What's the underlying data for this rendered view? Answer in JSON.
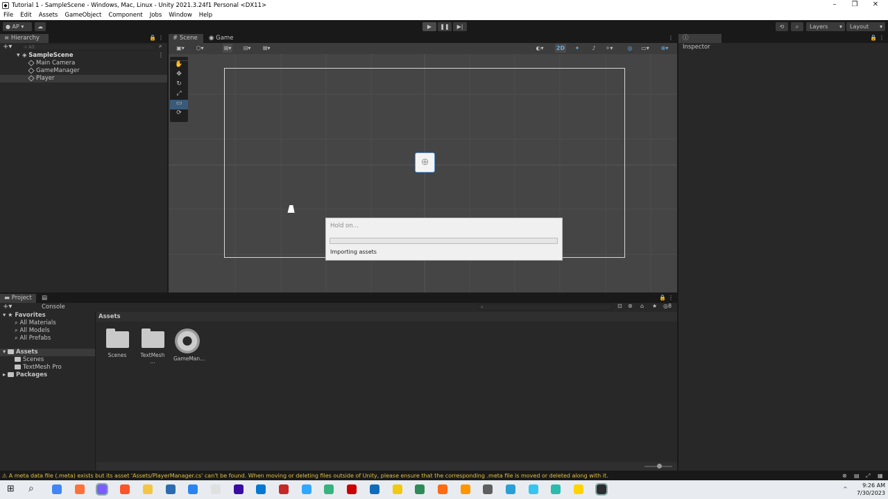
{
  "window": {
    "title": "Tutorial 1 - SampleScene - Windows, Mac, Linux - Unity 2021.3.24f1 Personal <DX11>",
    "controls": [
      "–",
      "❐",
      "✕"
    ]
  },
  "menubar": [
    "File",
    "Edit",
    "Assets",
    "GameObject",
    "Component",
    "Jobs",
    "Window",
    "Help"
  ],
  "toolbar": {
    "account_label": "AP",
    "layers_label": "Layers",
    "layout_label": "Layout"
  },
  "hierarchy": {
    "tab": "Hierarchy",
    "search_placeholder": "All",
    "scene": "SampleScene",
    "items": [
      "Main Camera",
      "GameManager",
      "Player"
    ]
  },
  "scene_panel": {
    "tabs": [
      "Scene",
      "Game"
    ],
    "mode_2d": "2D"
  },
  "inspector": {
    "tab": "Inspector"
  },
  "dialog": {
    "title": "Hold on...",
    "message": "Importing assets",
    "progress": 0
  },
  "project": {
    "tabs": [
      "Project",
      "Console"
    ],
    "favorites_label": "Favorites",
    "favorites": [
      "All Materials",
      "All Models",
      "All Prefabs"
    ],
    "assets_label": "Assets",
    "asset_folders": [
      "Scenes",
      "TextMesh Pro"
    ],
    "packages_label": "Packages",
    "breadcrumb": "Assets",
    "grid_items": [
      "Scenes",
      "TextMesh ...",
      "GameMan..."
    ],
    "hidden_count": "8"
  },
  "status": {
    "warning": "A meta data file (.meta) exists but its asset 'Assets/PlayerManager.cs' can't be found. When moving or deleting files outside of Unity, please ensure that the corresponding .meta file is moved or deleted along with it."
  },
  "taskbar": {
    "time": "9:26 AM",
    "date": "7/30/2023",
    "app_colors": [
      "#4285f4",
      "#ff7139",
      "#7b5cff",
      "#fb542b",
      "#f4c542",
      "#2b6cb0",
      "#2a84f0",
      "#e0e0e0",
      "#3a0ca3",
      "#0078d4",
      "#c62828",
      "#31a8ff",
      "#36b37e",
      "#cc0000",
      "#0f6cbd",
      "#f2c811",
      "#2e8b57",
      "#ff6a13",
      "#ff9500",
      "#5f5f5f",
      "#2a9fd6",
      "#36c5f0",
      "#2bbbad",
      "#ffd400",
      "#2d2d2d"
    ]
  }
}
